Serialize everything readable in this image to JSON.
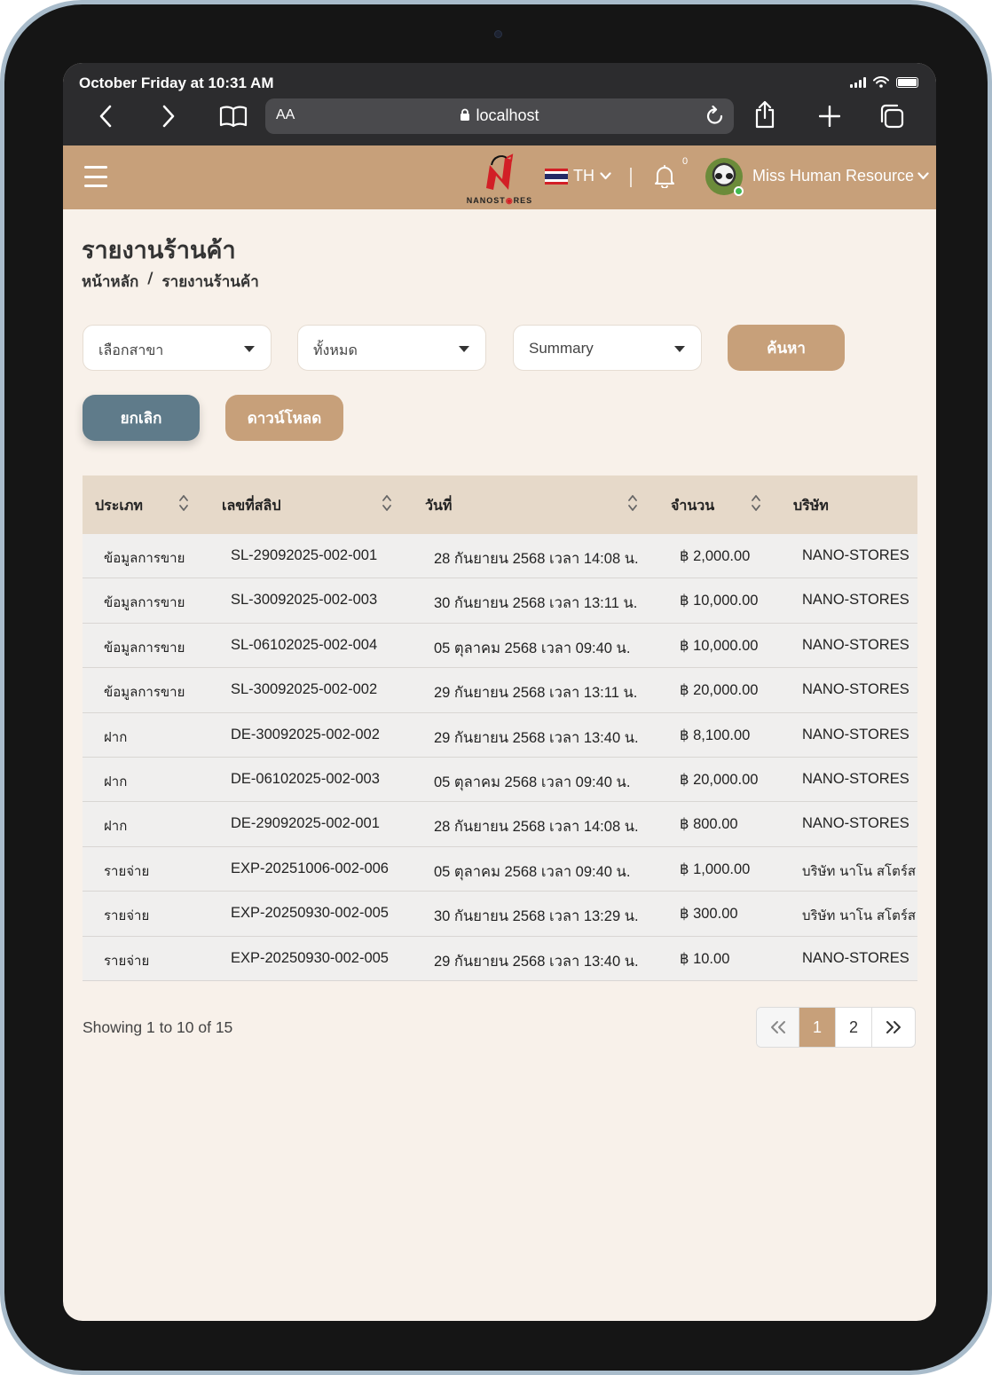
{
  "status_bar": {
    "time": "October Friday at 10:31 AM"
  },
  "browser": {
    "aa_label": "AA",
    "url": "localhost"
  },
  "header": {
    "logo_text_a": "NANO",
    "logo_text_b": "ST",
    "logo_text_c": "RES",
    "language": "TH",
    "notification_count": "0",
    "user_name": "Miss Human Resource"
  },
  "page": {
    "title": "รายงานร้านค้า",
    "breadcrumb": [
      "หน้าหลัก",
      "/",
      "รายงานร้านค้า"
    ]
  },
  "filters": {
    "branch": "เลือกสาขา",
    "type": "ทั้งหมด",
    "mode": "Summary",
    "search_label": "ค้นหา",
    "cancel_label": "ยกเลิก",
    "download_label": "ดาวน์โหลด"
  },
  "table": {
    "columns": [
      "ประเภท",
      "เลขที่สลิป",
      "วันที่",
      "จำนวน",
      "บริษัท"
    ],
    "rows": [
      [
        "ข้อมูลการขาย",
        "SL-29092025-002-001",
        "28 กันยายน 2568 เวลา 14:08 น.",
        "฿ 2,000.00",
        "NANO-STORES"
      ],
      [
        "ข้อมูลการขาย",
        "SL-30092025-002-003",
        "30 กันยายน 2568 เวลา 13:11 น.",
        "฿ 10,000.00",
        "NANO-STORES"
      ],
      [
        "ข้อมูลการขาย",
        "SL-06102025-002-004",
        "05 ตุลาคม 2568 เวลา 09:40 น.",
        "฿ 10,000.00",
        "NANO-STORES"
      ],
      [
        "ข้อมูลการขาย",
        "SL-30092025-002-002",
        "29 กันยายน 2568 เวลา 13:11 น.",
        "฿ 20,000.00",
        "NANO-STORES"
      ],
      [
        "ฝาก",
        "DE-30092025-002-002",
        "29 กันยายน 2568 เวลา 13:40 น.",
        "฿ 8,100.00",
        "NANO-STORES"
      ],
      [
        "ฝาก",
        "DE-06102025-002-003",
        "05 ตุลาคม 2568 เวลา 09:40 น.",
        "฿ 20,000.00",
        "NANO-STORES"
      ],
      [
        "ฝาก",
        "DE-29092025-002-001",
        "28 กันยายน 2568 เวลา 14:08 น.",
        "฿ 800.00",
        "NANO-STORES"
      ],
      [
        "รายจ่าย",
        "EXP-20251006-002-006",
        "05 ตุลาคม 2568 เวลา 09:40 น.",
        "฿ 1,000.00",
        "บริษัท นาโน สโตร์ส"
      ],
      [
        "รายจ่าย",
        "EXP-20250930-002-005",
        "30 กันยายน 2568 เวลา 13:29 น.",
        "฿ 300.00",
        "บริษัท นาโน สโตร์ส"
      ],
      [
        "รายจ่าย",
        "EXP-20250930-002-005",
        "29 กันยายน 2568 เวลา 13:40 น.",
        "฿ 10.00",
        "NANO-STORES"
      ]
    ]
  },
  "pagination": {
    "showing": "Showing 1 to 10 of 15",
    "first": "«",
    "pages": [
      "1",
      "2"
    ],
    "last": "»",
    "active_page": "1"
  },
  "colors": {
    "brand": "#c7a07a",
    "cancel": "#5f7b8a",
    "background": "#f8f1ea",
    "table_header": "#e6d9c9"
  }
}
